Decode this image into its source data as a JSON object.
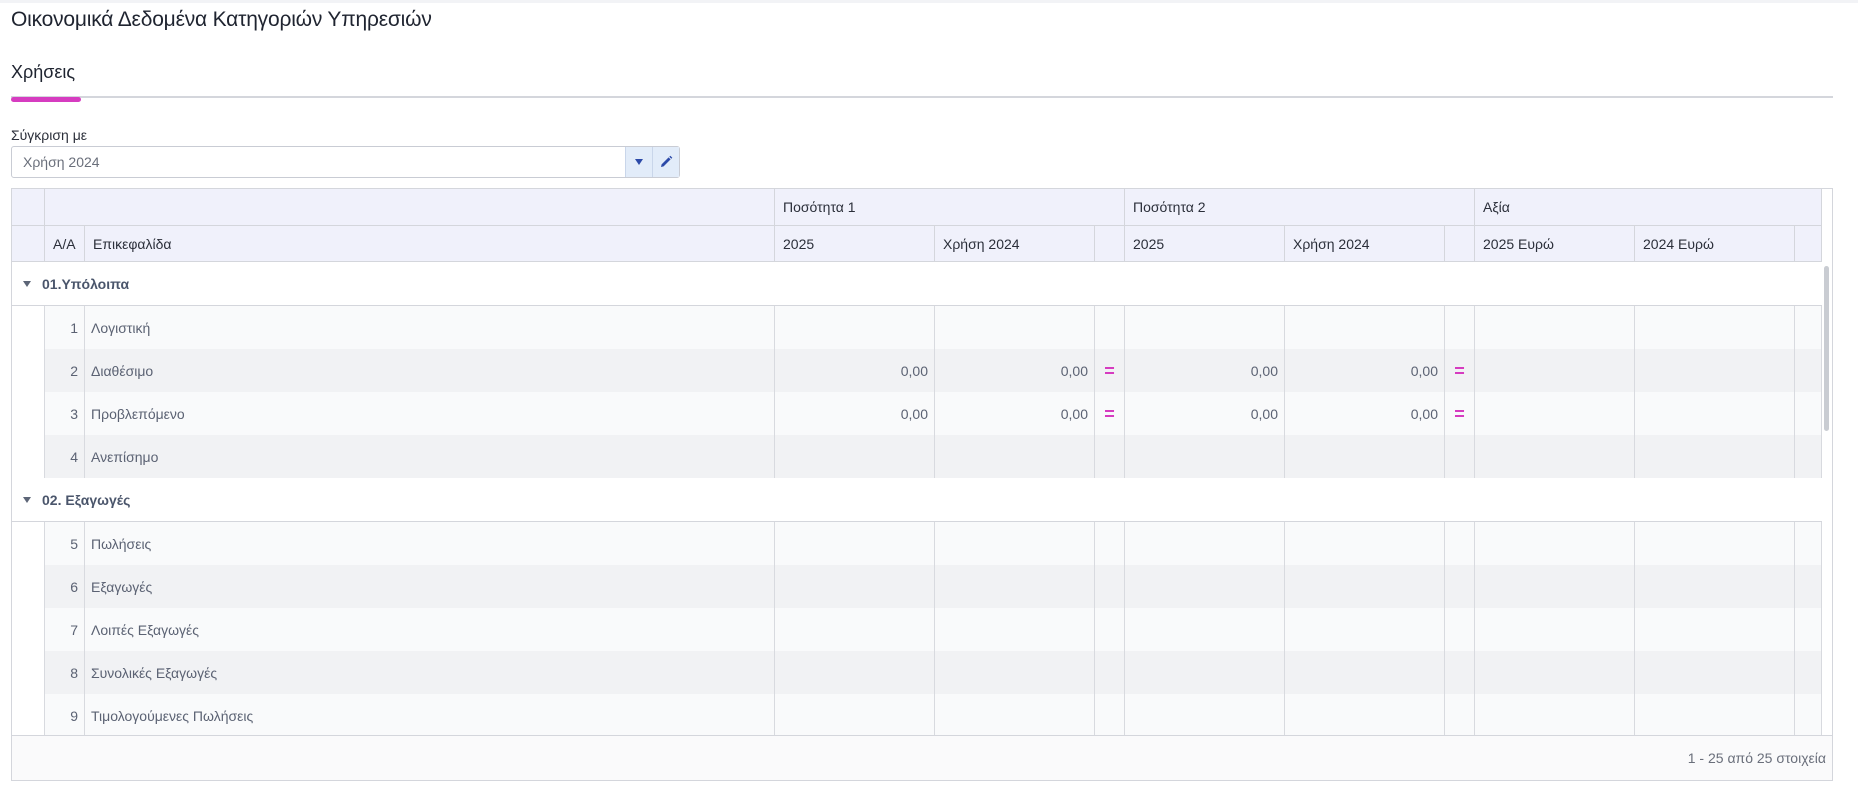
{
  "page": {
    "title": "Οικονομικά Δεδομένα Κατηγοριών Υπηρεσιών"
  },
  "tabs": [
    {
      "label": "Χρήσεις",
      "active": true
    }
  ],
  "compare": {
    "label": "Σύγκριση με",
    "value": "Χρήση 2024",
    "dropdown_icon": "triangle-down-icon",
    "edit_icon": "pencil-icon"
  },
  "grid": {
    "group_headers": {
      "qty1": "Ποσότητα 1",
      "qty2": "Ποσότητα 2",
      "value": "Αξία"
    },
    "columns": {
      "aa": "Α/Α",
      "heading": "Επικεφαλίδα",
      "q1_cur": "2025",
      "q1_prev": "Χρήση 2024",
      "q2_cur": "2025",
      "q2_prev": "Χρήση 2024",
      "v_cur": "2025 Ευρώ",
      "v_prev": "2024 Ευρώ"
    },
    "groups": [
      {
        "label": "01.Υπόλοιπα",
        "rows": [
          {
            "aa": "1",
            "heading": "Λογιστική",
            "q1_cur": "",
            "q1_prev": "",
            "q1_eq": false,
            "q2_cur": "",
            "q2_prev": "",
            "q2_eq": false,
            "v_cur": "",
            "v_prev": ""
          },
          {
            "aa": "2",
            "heading": "Διαθέσιμο",
            "q1_cur": "0,00",
            "q1_prev": "0,00",
            "q1_eq": true,
            "q2_cur": "0,00",
            "q2_prev": "0,00",
            "q2_eq": true,
            "v_cur": "",
            "v_prev": ""
          },
          {
            "aa": "3",
            "heading": "Προβλεπόμενο",
            "q1_cur": "0,00",
            "q1_prev": "0,00",
            "q1_eq": true,
            "q2_cur": "0,00",
            "q2_prev": "0,00",
            "q2_eq": true,
            "v_cur": "",
            "v_prev": ""
          },
          {
            "aa": "4",
            "heading": "Ανεπίσημο",
            "q1_cur": "",
            "q1_prev": "",
            "q1_eq": false,
            "q2_cur": "",
            "q2_prev": "",
            "q2_eq": false,
            "v_cur": "",
            "v_prev": ""
          }
        ]
      },
      {
        "label": "02. Εξαγωγές",
        "rows": [
          {
            "aa": "5",
            "heading": "Πωλήσεις",
            "q1_cur": "",
            "q1_prev": "",
            "q1_eq": false,
            "q2_cur": "",
            "q2_prev": "",
            "q2_eq": false,
            "v_cur": "",
            "v_prev": ""
          },
          {
            "aa": "6",
            "heading": "Εξαγωγές",
            "q1_cur": "",
            "q1_prev": "",
            "q1_eq": false,
            "q2_cur": "",
            "q2_prev": "",
            "q2_eq": false,
            "v_cur": "",
            "v_prev": ""
          },
          {
            "aa": "7",
            "heading": "Λοιπές Εξαγωγές",
            "q1_cur": "",
            "q1_prev": "",
            "q1_eq": false,
            "q2_cur": "",
            "q2_prev": "",
            "q2_eq": false,
            "v_cur": "",
            "v_prev": ""
          },
          {
            "aa": "8",
            "heading": "Συνολικές Εξαγωγές",
            "q1_cur": "",
            "q1_prev": "",
            "q1_eq": false,
            "q2_cur": "",
            "q2_prev": "",
            "q2_eq": false,
            "v_cur": "",
            "v_prev": ""
          },
          {
            "aa": "9",
            "heading": "Τιμολογούμενες Πωλήσεις",
            "q1_cur": "",
            "q1_prev": "",
            "q1_eq": false,
            "q2_cur": "",
            "q2_prev": "",
            "q2_eq": false,
            "v_cur": "",
            "v_prev": ""
          }
        ]
      }
    ],
    "equal_symbol": "=",
    "pager_info": "1 - 25 από 25 στοιχεία",
    "accent_color": "#d63cc0"
  }
}
